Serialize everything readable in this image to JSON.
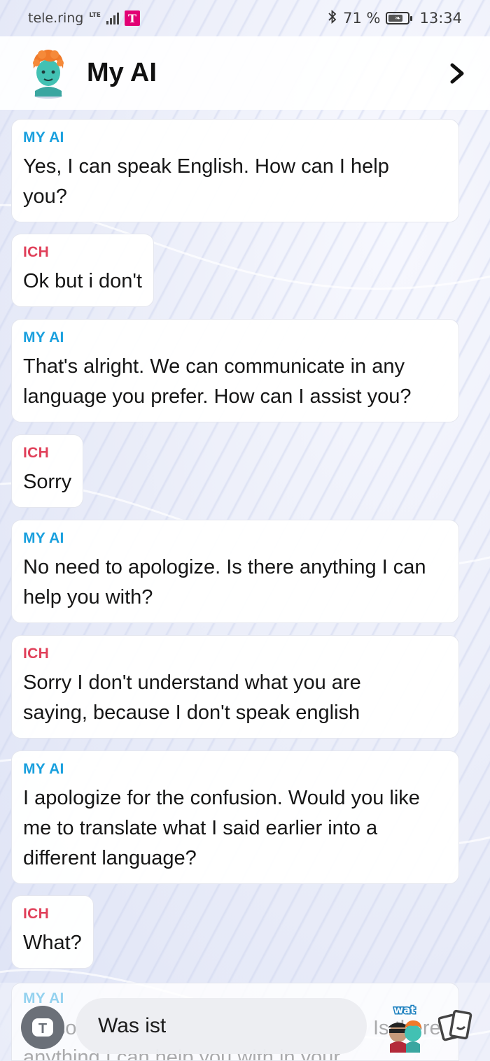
{
  "status_bar": {
    "carrier": "tele.ring",
    "network": "LTE",
    "operator_logo": "T",
    "battery": "71 %",
    "time": "13:34"
  },
  "header": {
    "title": "My AI"
  },
  "messages": [
    {
      "sender": "MY AI",
      "text": "Yes, I can speak English. How can I help you?"
    },
    {
      "sender": "ICH",
      "text": "Ok but i don't"
    },
    {
      "sender": "MY AI",
      "text": "That's alright. We can communicate in any language you prefer. How can I assist you?"
    },
    {
      "sender": "ICH",
      "text": "Sorry"
    },
    {
      "sender": "MY AI",
      "text": "No need to apologize. Is there anything I can help you with?"
    },
    {
      "sender": "ICH",
      "text": "Sorry I don't understand what you are saying, because I don't speak english"
    },
    {
      "sender": "MY AI",
      "text": "I apologize for the confusion. Would you like me to translate what I said earlier into a different language?"
    },
    {
      "sender": "ICH",
      "text": "What?"
    }
  ],
  "partial_message": {
    "sender": "MY AI",
    "line1": "I'm so",
    "line1_end": "Is there",
    "line2": "anything I can help you with in your"
  },
  "composer": {
    "input_value": "Was ist",
    "camera_button": "T",
    "bitmoji_label": "wat",
    "icons": [
      "camera-icon",
      "bitmoji-icon",
      "cards-icon"
    ]
  },
  "colors": {
    "ai_sender": "#1aa0de",
    "user_sender": "#e0405a"
  }
}
